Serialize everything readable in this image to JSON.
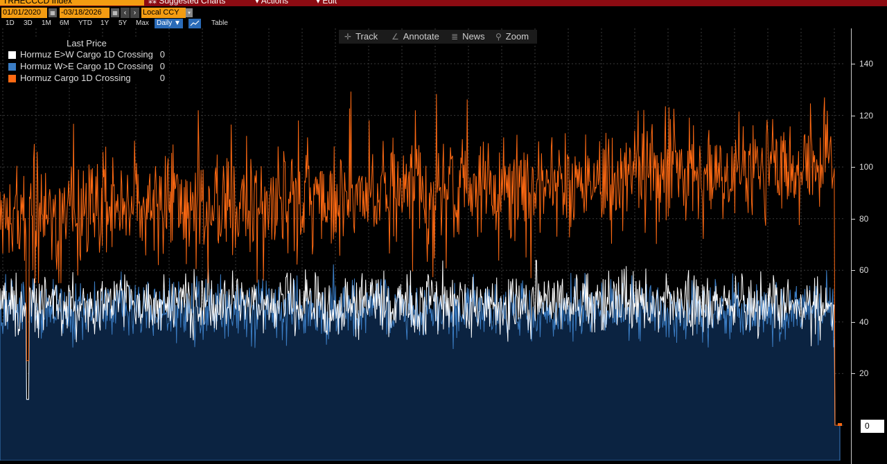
{
  "header": {
    "ticker": "TRHECCCD Index",
    "suggested": "Suggested Charts",
    "actions": "Actions",
    "edit": "Edit",
    "start_date": "01/01/2020",
    "end_date": "03/18/2026",
    "currency": "Local CCY"
  },
  "periods": [
    "1D",
    "3D",
    "1M",
    "6M",
    "YTD",
    "1Y",
    "5Y",
    "Max"
  ],
  "interval": "Daily ▼",
  "table_label": "Table",
  "toolbar": {
    "track": "Track",
    "annotate": "Annotate",
    "news": "News",
    "zoom": "Zoom"
  },
  "legend": {
    "title": "Last Price",
    "items": [
      {
        "name": "Hormuz E>W Cargo 1D Crossing",
        "value": "0",
        "color": "#ffffff"
      },
      {
        "name": "Hormuz W>E Cargo 1D Crossing",
        "value": "0",
        "color": "#3b7dc4"
      },
      {
        "name": "Hormuz Cargo 1D Crossing",
        "value": "0",
        "color": "#ff6a13"
      }
    ]
  },
  "last_value_tag": "0",
  "chart_data": {
    "type": "line",
    "x_range": [
      "2020-01-01",
      "2026-03-18"
    ],
    "ylim": [
      -20,
      150
    ],
    "yticks": [
      0,
      20,
      40,
      60,
      80,
      100,
      120,
      140
    ],
    "grid": true,
    "legend_position": "top-left",
    "series": [
      {
        "name": "Hormuz Cargo 1D Crossing",
        "color": "#ff6a13",
        "style": "line",
        "approx_mean_start": 80,
        "approx_mean_end": 102,
        "approx_range": [
          55,
          140
        ],
        "last": 0
      },
      {
        "name": "Hormuz W>E Cargo 1D Crossing",
        "color": "#3b7dc4",
        "style": "area",
        "approx_mean": 45,
        "approx_range": [
          15,
          75
        ],
        "last": 0
      },
      {
        "name": "Hormuz E>W Cargo 1D Crossing",
        "color": "#ffffff",
        "style": "line",
        "approx_mean": 47,
        "approx_range": [
          20,
          75
        ],
        "last": 0
      }
    ]
  }
}
